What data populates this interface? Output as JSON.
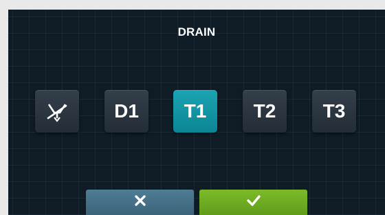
{
  "screen": {
    "title": "DRAIN"
  },
  "options": [
    {
      "label": "",
      "icon": "drain-valve-icon",
      "selected": false
    },
    {
      "label": "D1",
      "selected": false
    },
    {
      "label": "T1",
      "selected": true
    },
    {
      "label": "T2",
      "selected": false
    },
    {
      "label": "T3",
      "selected": false
    }
  ],
  "actions": {
    "cancel_icon": "close-icon",
    "confirm_icon": "check-icon"
  },
  "colors": {
    "background": "#0f1c26",
    "button": "#2b3641",
    "selected": "#12959f",
    "cancel": "#45708a",
    "confirm": "#6fae22"
  }
}
